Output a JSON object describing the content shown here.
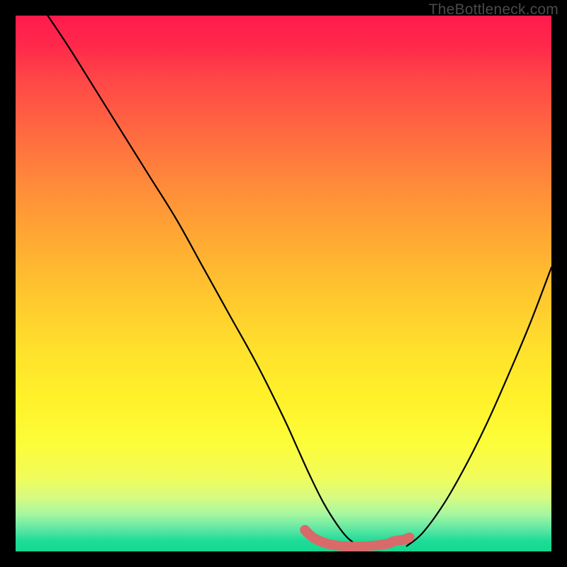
{
  "attribution": "TheBottleneck.com",
  "chart_data": {
    "type": "line",
    "title": "",
    "xlabel": "",
    "ylabel": "",
    "xlim": [
      0,
      100
    ],
    "ylim": [
      0,
      100
    ],
    "series": [
      {
        "name": "left-curve",
        "x": [
          6,
          10,
          15,
          20,
          25,
          30,
          35,
          40,
          45,
          50,
          52.5,
          55,
          57.5,
          60,
          62,
          64
        ],
        "values": [
          100,
          94,
          86,
          78,
          70,
          62,
          53,
          44,
          35,
          25,
          19.5,
          14,
          9,
          5,
          2.5,
          1
        ]
      },
      {
        "name": "right-curve",
        "x": [
          73,
          76,
          80,
          84,
          88,
          92,
          96,
          100
        ],
        "values": [
          1,
          3.5,
          9,
          16,
          24,
          33,
          42.5,
          53
        ]
      },
      {
        "name": "bottom-marker",
        "x": [
          54,
          55,
          56,
          58,
          60,
          62,
          64,
          66,
          68,
          70,
          70.5,
          72.5,
          73.5
        ],
        "values": [
          4,
          3,
          2.3,
          1.5,
          1.1,
          0.9,
          0.9,
          1.0,
          1.2,
          1.6,
          1.9,
          2.2,
          2.6
        ]
      }
    ],
    "background_gradient_stops": [
      {
        "pos": 0,
        "color": "#ff1a4d"
      },
      {
        "pos": 50,
        "color": "#ffc62f"
      },
      {
        "pos": 80,
        "color": "#fcfd3a"
      },
      {
        "pos": 100,
        "color": "#14d88f"
      }
    ]
  }
}
